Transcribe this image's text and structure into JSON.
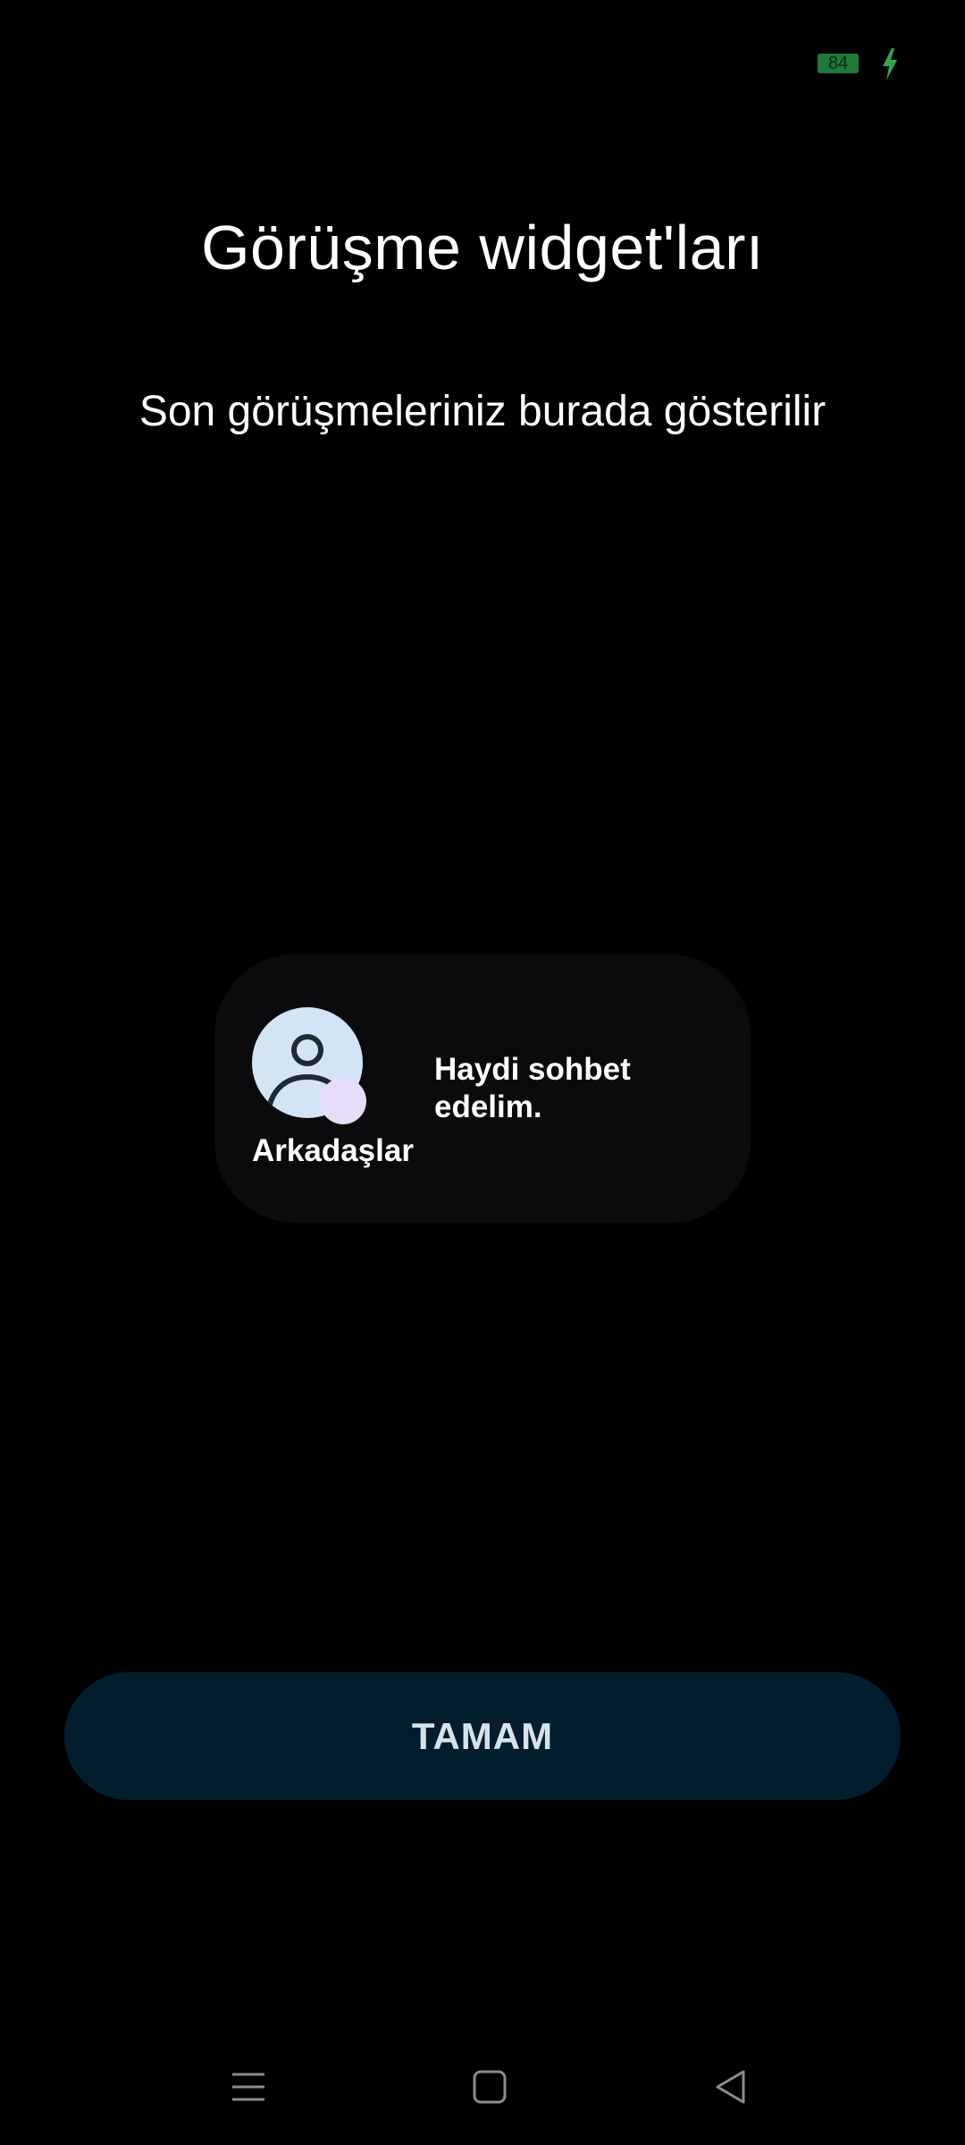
{
  "status_bar": {
    "battery_level": "84",
    "battery_color": "#1f7a3a",
    "charging_icon": "bolt-icon",
    "charging_color": "#2fa84f"
  },
  "header": {
    "title": "Görüşme widget'ları",
    "subtitle": "Son görüşmeleriniz burada gösterilir"
  },
  "widget_preview": {
    "avatar_icon": "person-icon",
    "contact_name": "Arkadaşlar",
    "message": "Haydi sohbet edelim.",
    "colors": {
      "card_background": "#0b0b0d",
      "avatar_background": "#d3e4f5",
      "presence_dot": "#e6ddf9"
    }
  },
  "actions": {
    "ok_label": "TAMAM",
    "ok_background": "#021d2b"
  },
  "navigation_bar": {
    "items": [
      {
        "icon": "menu-icon"
      },
      {
        "icon": "home-square-icon"
      },
      {
        "icon": "back-triangle-icon"
      }
    ]
  }
}
